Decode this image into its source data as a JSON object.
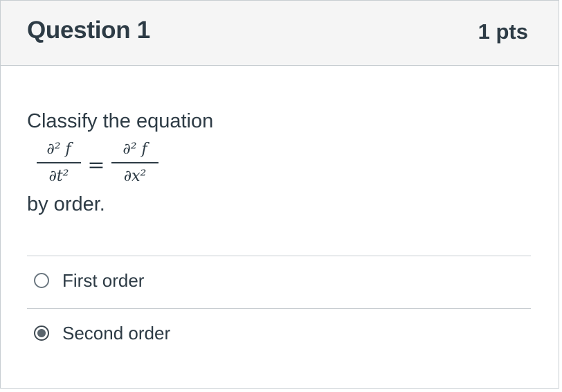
{
  "question": {
    "title": "Question 1",
    "points": "1 pts",
    "prompt": "Classify the equation",
    "equation": {
      "lhs_numerator": "∂² f",
      "lhs_denominator": "∂t²",
      "operator": "=",
      "rhs_numerator": "∂² f",
      "rhs_denominator": "∂x²"
    },
    "suffix": "by order."
  },
  "answers": [
    {
      "label": "First order",
      "selected": false
    },
    {
      "label": "Second order",
      "selected": true
    }
  ],
  "colors": {
    "header_bg": "#f5f5f5",
    "text": "#2d3b45",
    "border": "#c7cdd1"
  }
}
